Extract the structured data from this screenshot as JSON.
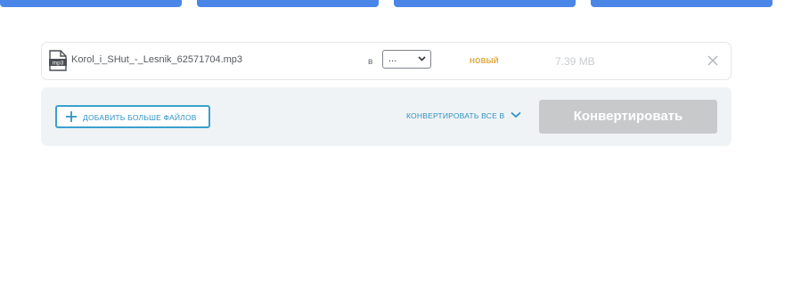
{
  "file": {
    "icon": "mp3-file-icon",
    "icon_label": "mp3",
    "name": "Korol_i_SHut_-_Lesnik_62571704.mp3",
    "to_label": "в",
    "format_value": "...",
    "status": "НОВЫЙ",
    "size": "7.39 MB",
    "remove_icon": "close-icon"
  },
  "actions": {
    "add_more_label": "ДОБАВИТЬ БОЛЬШЕ ФАЙЛОВ",
    "convert_all_label": "КОНВЕРТИРОВАТЬ ВСЕ В",
    "convert_button_label": "Конвертировать"
  },
  "colors": {
    "tab_blue": "#4a86e8",
    "accent": "#2f93c4",
    "status_new": "#e0a431",
    "disabled_button": "#c8c9cb"
  }
}
